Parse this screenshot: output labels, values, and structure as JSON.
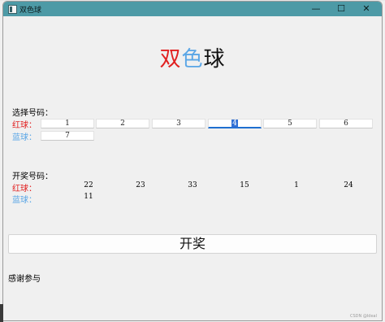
{
  "window": {
    "title": "双色球",
    "minimize_glyph": "—",
    "maximize_glyph": "☐",
    "close_glyph": "✕"
  },
  "heading": {
    "part1": "双",
    "part2": "色",
    "part3": "球"
  },
  "selection": {
    "label": "选择号码：",
    "red_label": "红球：",
    "blue_label": "蓝球：",
    "red_inputs": [
      "1",
      "2",
      "3",
      "4",
      "5",
      "6"
    ],
    "blue_inputs": [
      "7"
    ],
    "focused_index": 3
  },
  "draw": {
    "label": "开奖号码：",
    "red_label": "红球：",
    "blue_label": "蓝球：",
    "red_results": [
      "22",
      "23",
      "33",
      "15",
      "1",
      "24"
    ],
    "blue_results": [
      "11"
    ]
  },
  "draw_button_label": "开奖",
  "status_message": "感谢参与",
  "watermark": "CSDN @Ideal",
  "colors": {
    "titlebar": "#4d9aa6",
    "red_ball": "#e12020",
    "blue_ball": "#5aa6e6",
    "focus_accent": "#1e6fd0"
  }
}
